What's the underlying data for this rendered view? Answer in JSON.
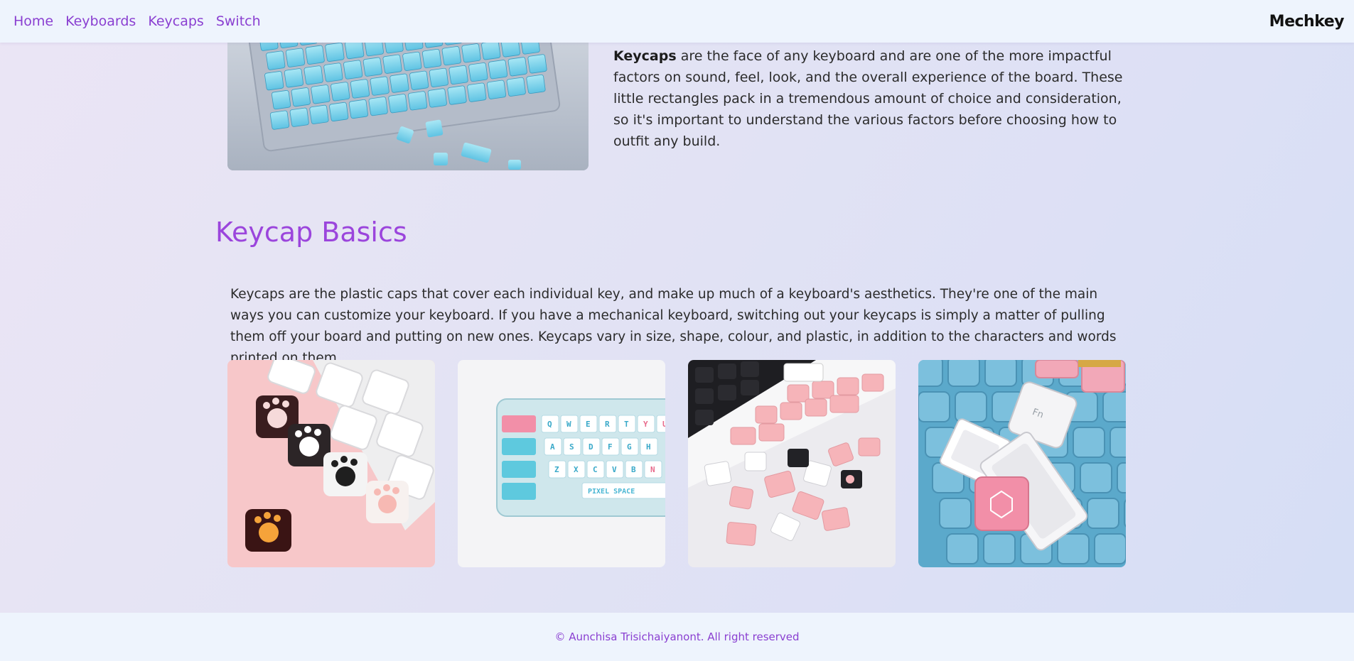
{
  "nav": {
    "links": [
      "Home",
      "Keyboards",
      "Keycaps",
      "Switch"
    ],
    "brand": "Mechkey"
  },
  "intro": {
    "bold_lead": "Keycaps",
    "text": " are the face of any keyboard and are one of the more impactful factors on sound, feel, look, and the overall experience of the board. These little rectangles pack in a tremendous amount of choice and consideration, so it's important to understand the various factors before choosing how to outfit any build."
  },
  "basics": {
    "title": "Keycap Basics",
    "text": "Keycaps are the plastic caps that cover each individual key, and make up much of a keyboard's aesthetics. They're one of the main ways you can customize your keyboard. If you have a mechanical keyboard, switching out your keycaps is simply a matter of pulling them off your board and putting on new ones. Keycaps vary in size, shape, colour, and plastic, in addition to the characters and words printed on them."
  },
  "gallery": {
    "tile2_keys": [
      "Q",
      "W",
      "E",
      "R",
      "T",
      "Y",
      "U",
      "A",
      "S",
      "D",
      "F",
      "G",
      "H",
      "Z",
      "X",
      "C",
      "V",
      "B",
      "N"
    ],
    "tile2_space": "PIXEL SPACE",
    "tile4_key": "Fn"
  },
  "footer": {
    "text": "© Aunchisa Trisichaiyanont. All right reserved"
  },
  "colors": {
    "accent": "#8a3fd1",
    "title": "#9b45dc",
    "nav_bg": "#eef4fd"
  }
}
